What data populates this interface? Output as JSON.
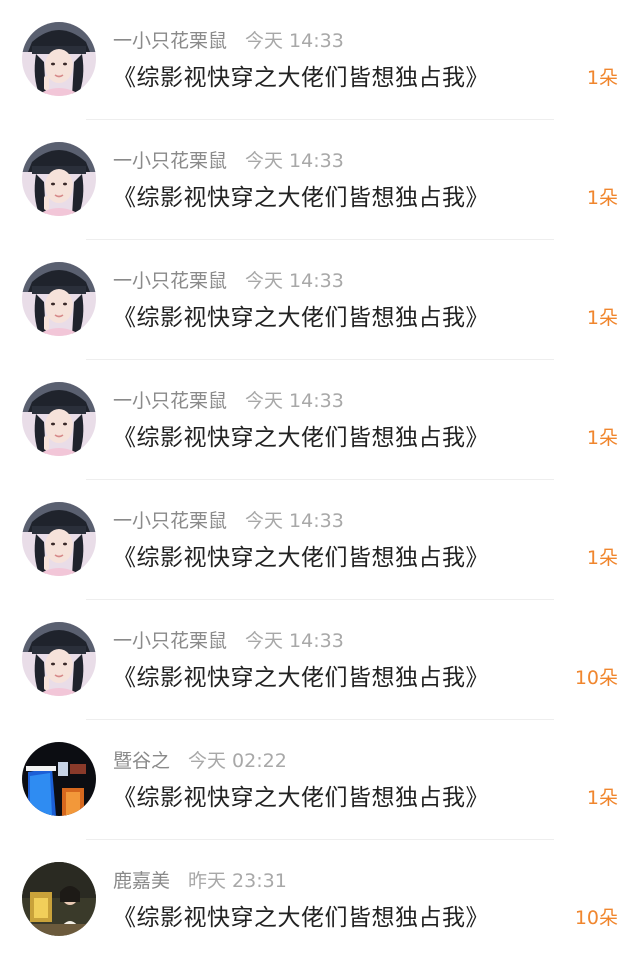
{
  "colors": {
    "accent": "#f0862e",
    "name": "#8a8a8a",
    "time": "#a8a8a8",
    "title": "#222222",
    "divider": "#eeeeee"
  },
  "gifts": [
    {
      "avatar": "avatar-girl-icon",
      "name": "一小只花栗鼠",
      "time": "今天 14:33",
      "title": "《综影视快穿之大佬们皆想独占我》",
      "amount": "1朵"
    },
    {
      "avatar": "avatar-girl-icon",
      "name": "一小只花栗鼠",
      "time": "今天 14:33",
      "title": "《综影视快穿之大佬们皆想独占我》",
      "amount": "1朵"
    },
    {
      "avatar": "avatar-girl-icon",
      "name": "一小只花栗鼠",
      "time": "今天 14:33",
      "title": "《综影视快穿之大佬们皆想独占我》",
      "amount": "1朵"
    },
    {
      "avatar": "avatar-girl-icon",
      "name": "一小只花栗鼠",
      "time": "今天 14:33",
      "title": "《综影视快穿之大佬们皆想独占我》",
      "amount": "1朵"
    },
    {
      "avatar": "avatar-girl-icon",
      "name": "一小只花栗鼠",
      "time": "今天 14:33",
      "title": "《综影视快穿之大佬们皆想独占我》",
      "amount": "1朵"
    },
    {
      "avatar": "avatar-girl-icon",
      "name": "一小只花栗鼠",
      "time": "今天 14:33",
      "title": "《综影视快穿之大佬们皆想独占我》",
      "amount": "10朵"
    },
    {
      "avatar": "avatar-neon-icon",
      "name": "暨谷之",
      "time": "今天 02:22",
      "title": "《综影视快穿之大佬们皆想独占我》",
      "amount": "1朵"
    },
    {
      "avatar": "avatar-photo-icon",
      "name": "鹿嘉美",
      "time": "昨天 23:31",
      "title": "《综影视快穿之大佬们皆想独占我》",
      "amount": "10朵"
    }
  ]
}
